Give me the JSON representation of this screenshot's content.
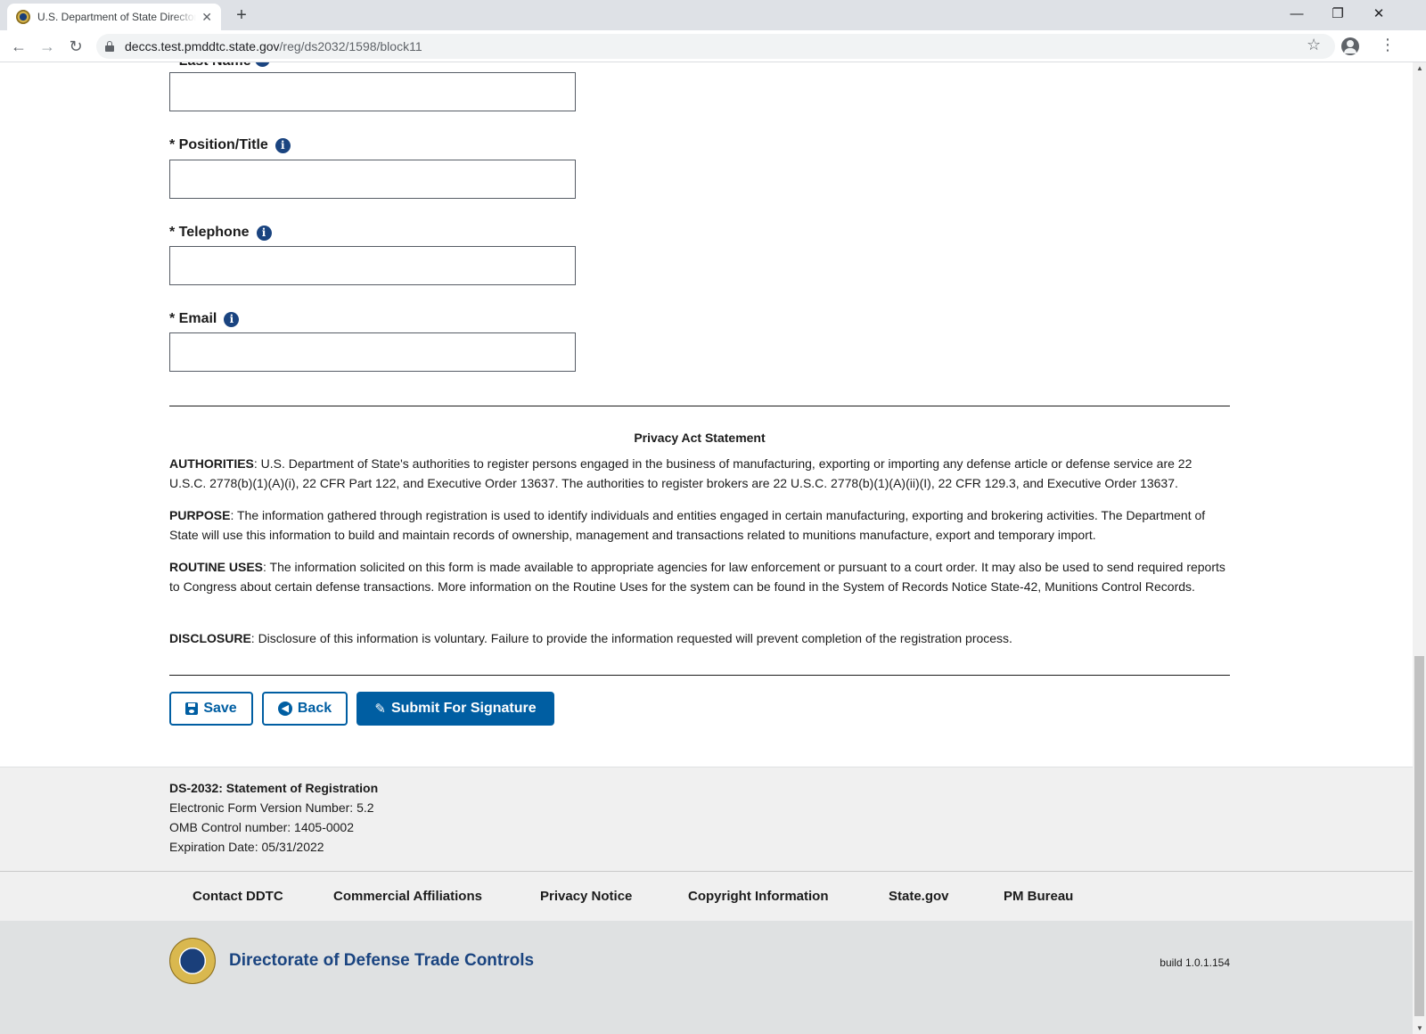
{
  "browser": {
    "tab_title": "U.S. Department of State Directorate of Defense Trade Controls",
    "url_host": "deccs.test.pmddtc.state.gov",
    "url_path": "/reg/ds2032/1598/block11",
    "new_tab": "+",
    "tab_close": "✕",
    "minimize": "—",
    "restore": "❐",
    "close": "✕",
    "back": "←",
    "forward": "→",
    "reload": "↻",
    "bookmark": "☆",
    "menu": "⋮"
  },
  "form": {
    "cut_label": "* Last Name",
    "fields": [
      {
        "label": "* Position/Title",
        "value": ""
      },
      {
        "label": "* Telephone",
        "value": ""
      },
      {
        "label": "* Email",
        "value": ""
      }
    ],
    "info_glyph": "i"
  },
  "privacy": {
    "title": "Privacy Act Statement",
    "paragraphs": [
      {
        "heading": "AUTHORITIES",
        "text": ": U.S. Department of State's authorities to register persons engaged in the business of manufacturing, exporting or importing any defense article or defense service are 22 U.S.C. 2778(b)(1)(A)(i), 22 CFR Part 122, and Executive Order 13637. The authorities to register brokers are 22 U.S.C. 2778(b)(1)(A)(ii)(I), 22 CFR 129.3, and Executive Order 13637."
      },
      {
        "heading": "PURPOSE",
        "text": ": The information gathered through registration is used to identify individuals and entities engaged in certain manufacturing, exporting and brokering activities. The Department of State will use this information to build and maintain records of ownership, management and transactions related to munitions manufacture, export and temporary import."
      },
      {
        "heading": "ROUTINE USES",
        "text": ": The information solicited on this form is made available to appropriate agencies for law enforcement or pursuant to a court order. It may also be used to send required reports to Congress about certain defense transactions. More information on the Routine Uses for the system can be found in the System of Records Notice State-42, Munitions Control Records."
      },
      {
        "heading": "DISCLOSURE",
        "text": ": Disclosure of this information is voluntary. Failure to provide the information requested will prevent completion of the registration process."
      }
    ]
  },
  "actions": {
    "save": "Save",
    "back": "Back",
    "submit": "Submit For Signature",
    "back_glyph": "◀",
    "submit_glyph": "✎"
  },
  "form_info": {
    "title": "DS-2032: Statement of Registration",
    "version": "Electronic Form Version Number: 5.2",
    "omb": "OMB Control number: 1405-0002",
    "expiration": "Expiration Date: 05/31/2022"
  },
  "footer_links": [
    "Contact DDTC",
    "Commercial Affiliations",
    "Privacy Notice",
    "Copyright Information",
    "State.gov",
    "PM Bureau"
  ],
  "footer": {
    "agency": "Directorate of Defense Trade Controls",
    "build": "build 1.0.1.154"
  },
  "colors": {
    "primary": "#005ea2",
    "info_icon": "#1a4480",
    "footer_band": "#dfe1e2"
  },
  "icons": [
    "tab-favicon-icon",
    "lock-icon",
    "star-icon",
    "profile-icon",
    "info-icon",
    "save-icon",
    "back-arrow-icon",
    "signature-icon",
    "ddtc-seal-icon"
  ]
}
